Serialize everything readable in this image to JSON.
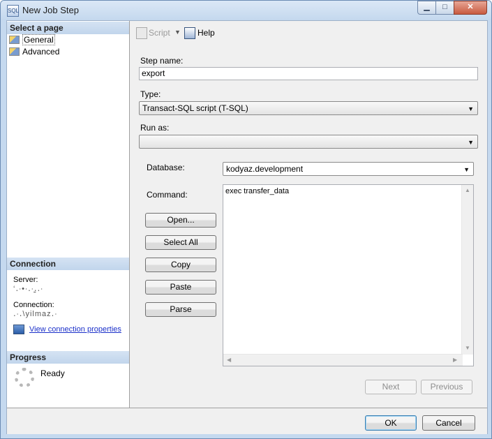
{
  "window": {
    "title": "New Job Step",
    "app_icon_text": "SQL",
    "min_glyph": "▁",
    "max_glyph": "□",
    "close_glyph": "✕"
  },
  "select_page": {
    "header": "Select a page",
    "items": [
      {
        "label": "General",
        "selected": true
      },
      {
        "label": "Advanced",
        "selected": false
      }
    ]
  },
  "connection": {
    "header": "Connection",
    "server_label": "Server:",
    "server_value": "‘․∙•∙․∙․̱․∙",
    "connection_label": "Connection:",
    "connection_value": "․∙․\\yilmaz․∙",
    "link": "View connection properties"
  },
  "progress": {
    "header": "Progress",
    "status": "Ready"
  },
  "toolbar": {
    "script_label": "Script",
    "dropdown_glyph": "▼",
    "help_label": "Help"
  },
  "form": {
    "step_name_label": "Step name:",
    "step_name_value": "export",
    "type_label": "Type:",
    "type_value": "Transact-SQL script (T-SQL)",
    "run_as_label": "Run as:",
    "run_as_value": "",
    "database_label": "Database:",
    "database_value": "kodyaz.development",
    "command_label": "Command:",
    "command_value": "exec transfer_data",
    "combo_arrow": "▼"
  },
  "command_buttons": {
    "open": "Open...",
    "select_all": "Select All",
    "copy": "Copy",
    "paste": "Paste",
    "parse": "Parse"
  },
  "scroll_glyphs": {
    "up": "▲",
    "down": "▼",
    "left": "◀",
    "right": "▶"
  },
  "nav_buttons": {
    "next": "Next",
    "previous": "Previous"
  },
  "dialog_buttons": {
    "ok": "OK",
    "cancel": "Cancel"
  }
}
